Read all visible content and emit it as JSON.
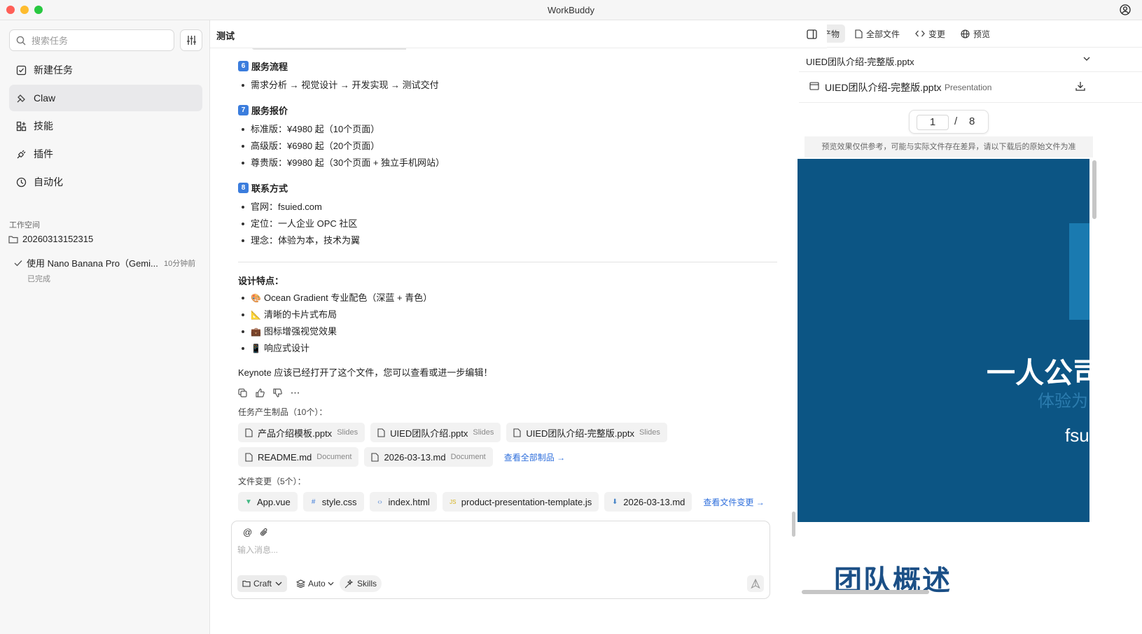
{
  "window": {
    "title": "WorkBuddy"
  },
  "sidebar": {
    "search_placeholder": "搜索任务",
    "nav": [
      {
        "label": "新建任务",
        "icon": "new-task-icon"
      },
      {
        "label": "Claw",
        "icon": "claw-icon",
        "active": true
      },
      {
        "label": "技能",
        "icon": "skills-icon"
      },
      {
        "label": "插件",
        "icon": "plugin-icon"
      },
      {
        "label": "自动化",
        "icon": "clock-icon"
      }
    ],
    "workspace_label": "工作空间",
    "workspace_folder": "20260313152315",
    "task": {
      "title": "使用 Nano Banana Pro（Gemi...",
      "time": "10分钟前",
      "status": "已完成"
    }
  },
  "center": {
    "title": "测试",
    "sections": [
      {
        "num": "6",
        "title": "服务流程",
        "items": [
          "需求分析 → 视觉设计 → 开发实现 → 测试交付"
        ]
      },
      {
        "num": "7",
        "title": "服务报价",
        "items": [
          "标准版：¥4980 起（10个页面）",
          "高级版：¥6980 起（20个页面）",
          "尊贵版：¥9980 起（30个页面 + 独立手机网站）"
        ]
      },
      {
        "num": "8",
        "title": "联系方式",
        "items": [
          "官网：fsuied.com",
          "定位：一人企业 OPC 社区",
          "理念：体验为本，技术为翼"
        ]
      }
    ],
    "design": {
      "title": "设计特点：",
      "items": [
        {
          "emoji": "🎨",
          "text": "Ocean Gradient 专业配色（深蓝 + 青色）"
        },
        {
          "emoji": "📐",
          "text": "清晰的卡片式布局"
        },
        {
          "emoji": "💼",
          "text": "图标增强视觉效果"
        },
        {
          "emoji": "📱",
          "text": "响应式设计"
        }
      ]
    },
    "closing": "Keynote 应该已经打开了这个文件，您可以查看或进一步编辑！",
    "products_label": "任务产生制品（10个）：",
    "products_row1": [
      {
        "name": "产品介绍模板.pptx",
        "kind": "Slides"
      },
      {
        "name": "UIED团队介绍.pptx",
        "kind": "Slides"
      },
      {
        "name": "UIED团队介绍-完整版.pptx",
        "kind": "Slides"
      }
    ],
    "products_row2": [
      {
        "name": "README.md",
        "kind": "Document"
      },
      {
        "name": "2026-03-13.md",
        "kind": "Document"
      }
    ],
    "view_all_products": "查看全部制品 →",
    "changes_label": "文件变更（5个）：",
    "changes": [
      {
        "name": "App.vue",
        "icon": "vue-icon",
        "color": "#41b883"
      },
      {
        "name": "style.css",
        "icon": "css-icon",
        "color": "#3d7bd9"
      },
      {
        "name": "index.html",
        "icon": "html-icon",
        "color": "#5b8dd6"
      },
      {
        "name": "product-presentation-template.js",
        "icon": "js-icon",
        "color": "#d6b21c"
      },
      {
        "name": "2026-03-13.md",
        "icon": "markdown-icon",
        "color": "#4a86c8"
      }
    ],
    "view_all_changes": "查看文件变更 →",
    "composer": {
      "placeholder": "输入消息...",
      "mode": "Craft",
      "model": "Auto",
      "skills": "Skills"
    }
  },
  "right": {
    "tabs": [
      {
        "label": "产物",
        "icon": "artifact-icon",
        "active": true
      },
      {
        "label": "全部文件",
        "icon": "file-icon"
      },
      {
        "label": "变更",
        "icon": "code-icon"
      },
      {
        "label": "预览",
        "icon": "globe-icon"
      }
    ],
    "selected_file": "UIED团队介绍-完整版.pptx",
    "file_name": "UIED团队介绍-完整版.pptx",
    "file_type": "Presentation",
    "page_current": "1",
    "page_sep": "/",
    "page_total": "8",
    "notice": "预览效果仅供参考，可能与实际文件存在差异，请以下载后的原始文件为准",
    "slide1": {
      "title": "一人公司",
      "subtitle": "体验为",
      "url": "fsu"
    },
    "slide2_title": "团队概述",
    "colors": {
      "slide_bg": "#0c5584",
      "slide2_title": "#1b4f86",
      "accent_link": "#2f6fdc"
    }
  }
}
